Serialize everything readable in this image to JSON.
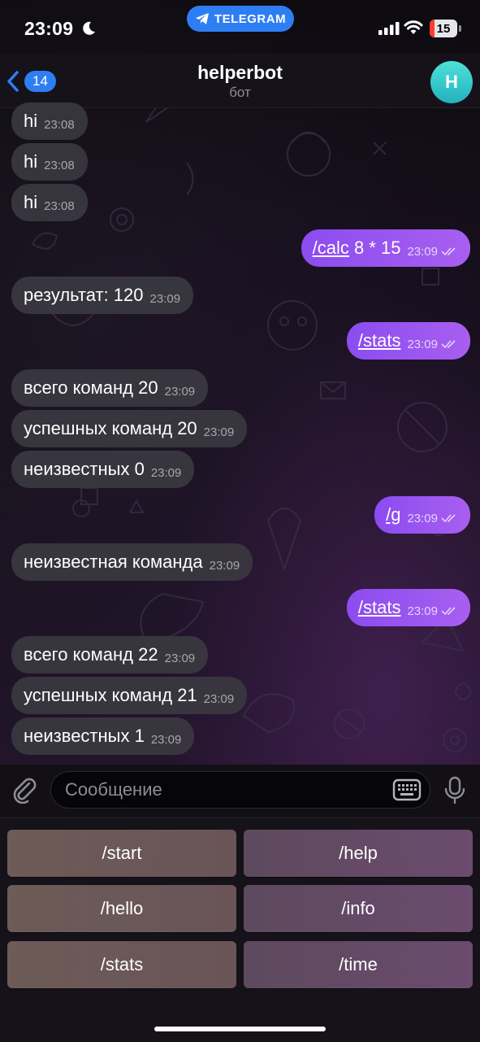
{
  "status_bar": {
    "time": "23:09",
    "pill_label": "TELEGRAM",
    "battery_level": "15"
  },
  "header": {
    "back_count": "14",
    "title": "helperbot",
    "subtitle": "бот",
    "avatar_letter": "H"
  },
  "messages": [
    {
      "dir": "in",
      "text": "hi",
      "time": "23:08"
    },
    {
      "dir": "in",
      "text": "hi",
      "time": "23:08"
    },
    {
      "dir": "in",
      "text": "hi",
      "time": "23:08"
    },
    {
      "dir": "out",
      "command": "/calc",
      "text": " 8 * 15",
      "time": "23:09"
    },
    {
      "dir": "in",
      "text": "результат: 120",
      "time": "23:09"
    },
    {
      "dir": "out",
      "command": "/stats",
      "text": "",
      "time": "23:09"
    },
    {
      "dir": "in",
      "text": "всего команд 20",
      "time": "23:09"
    },
    {
      "dir": "in",
      "text": "успешных команд 20",
      "time": "23:09"
    },
    {
      "dir": "in",
      "text": "неизвестных 0",
      "time": "23:09"
    },
    {
      "dir": "out",
      "command": "/g",
      "text": "",
      "time": "23:09"
    },
    {
      "dir": "in",
      "text": "неизвестная команда",
      "time": "23:09"
    },
    {
      "dir": "out",
      "command": "/stats",
      "text": "",
      "time": "23:09"
    },
    {
      "dir": "in",
      "text": "всего команд 22",
      "time": "23:09"
    },
    {
      "dir": "in",
      "text": "успешных команд 21",
      "time": "23:09"
    },
    {
      "dir": "in",
      "text": "неизвестных 1",
      "time": "23:09"
    }
  ],
  "input": {
    "placeholder": "Сообщение"
  },
  "keyboard": {
    "buttons": [
      "/start",
      "/help",
      "/hello",
      "/info",
      "/stats",
      "/time"
    ]
  },
  "colors": {
    "accent_blue": "#2e7ef3",
    "outgoing_bubble": "#9b57f0",
    "incoming_bubble": "#3a3840",
    "avatar": "#2fc6cc"
  },
  "icons": [
    "moon-icon",
    "telegram-plane-icon",
    "signal-icon",
    "wifi-icon",
    "battery-icon",
    "chevron-left-icon",
    "paperclip-icon",
    "keyboard-icon",
    "microphone-icon",
    "double-check-icon"
  ]
}
